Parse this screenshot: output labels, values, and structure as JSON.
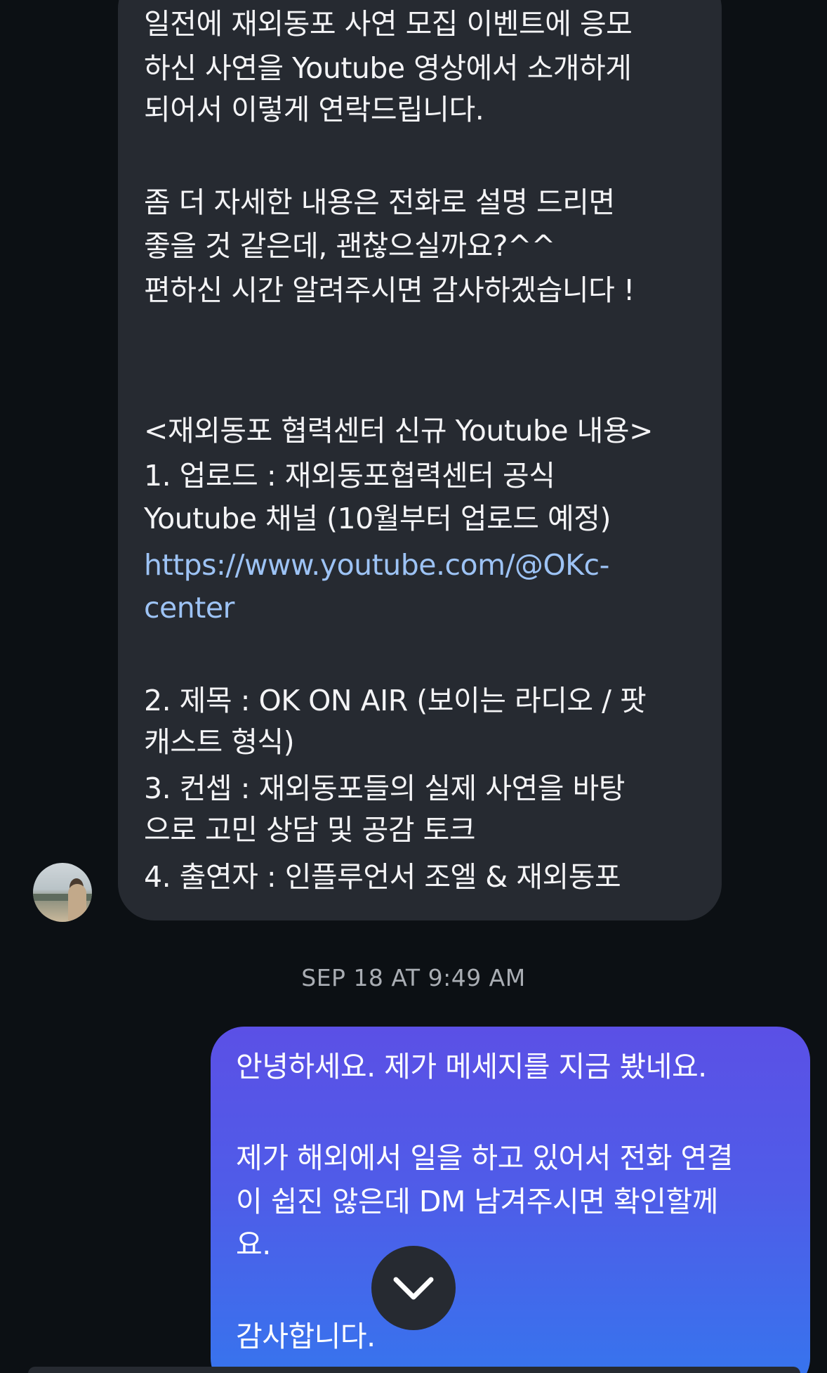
{
  "thread": {
    "incoming_message": {
      "lines": [
        "일전에 재외동포 사연 모집 이벤트에 응모",
        "하신 사연을 Youtube 영상에서 소개하게",
        "되어서 이렇게 연락드립니다.",
        "좀 더 자세한 내용은 전화로 설명 드리면",
        "좋을 것 같은데, 괜찮으실까요?^^",
        "편하신 시간 알려주시면 감사하겠습니다 !",
        "<재외동포 협력센터 신규 Youtube 내용>",
        "1. 업로드 : 재외동포협력센터 공식",
        "Youtube 채널 (10월부터 업로드 예정)",
        "https://www.youtube.com/@OKc-",
        "center",
        "2. 제목 : OK ON AIR (보이는 라디오 / 팟",
        "캐스트 형식)",
        "3. 컨셉 : 재외동포들의 실제 사연을 바탕",
        "으로 고민 상담 및 공감 토크",
        "4. 출연자 : 인플루언서 조엘 & 재외동포"
      ]
    },
    "timestamp": "SEP 18 AT 9:49 AM",
    "outgoing_message": {
      "lines": [
        "안녕하세요. 제가 메세지를 지금 봤네요.",
        "제가 해외에서 일을 하고 있어서 전화 연결",
        "이 쉽진 않은데 DM 남겨주시면 확인할께",
        "요.",
        "감사합니다."
      ]
    }
  },
  "icons": {
    "scroll_down": "chevron-down-icon",
    "avatar": "profile-photo"
  },
  "colors": {
    "background": "#0c1014",
    "incoming_bubble": "#262a31",
    "outgoing_gradient_top": "#5b50e6",
    "outgoing_gradient_bottom": "#3576ee",
    "link": "#9dc3f5"
  }
}
